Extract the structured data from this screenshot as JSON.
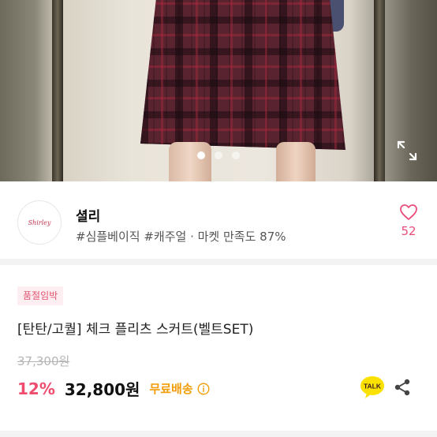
{
  "gallery": {
    "image_alt": "plaid pleated skirt photo",
    "slide_count": 3,
    "active_slide": 1,
    "expand_icon": "expand-icon"
  },
  "shop": {
    "avatar_text": "Shirley",
    "name": "셜리",
    "tags": "#심플베이직 #캐주얼 · 마켓 만족도 87%",
    "like_icon": "heart-icon",
    "like_count": "52"
  },
  "product": {
    "badge": "품절임박",
    "title": "[탄탄/고퀄] 체크 플리츠 스커트(벨트SET)",
    "original_price": "37,300원",
    "discount": "12%",
    "sale_price": "32,800원",
    "shipping": "무료배송",
    "info_icon": "info-icon",
    "talk_label": "TALK",
    "share_icon": "share-icon"
  },
  "colors": {
    "accent_pink": "#ef4d6f",
    "heart_pink": "#ea4d7a",
    "badge_bg": "#fdeef2",
    "shipping_orange": "#f29d07",
    "talk_yellow": "#fae100"
  }
}
